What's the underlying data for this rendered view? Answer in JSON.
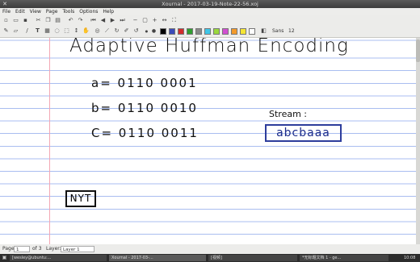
{
  "window": {
    "title": "Xournal - 2017-03-19-Note-22-56.xoj"
  },
  "menu": [
    "File",
    "Edit",
    "View",
    "Page",
    "Tools",
    "Options",
    "Help"
  ],
  "toolbar2": {
    "font": "Sans",
    "font_size": "12"
  },
  "colors": {
    "pen": "#111111",
    "stream_box": "#2d3d9c",
    "rule": "#a9bdf0",
    "margin": "#f3a6b4"
  },
  "swatches": [
    "#000000",
    "#3b4bb8",
    "#d12c2c",
    "#2f9e2f",
    "#8a8a8a",
    "#3ec6e8",
    "#9ad83c",
    "#d14fd1",
    "#f39a2a",
    "#f5e534",
    "#ffffff"
  ],
  "note": {
    "title": "Adaptive Huffman Encoding",
    "line_a": "a= 0110 0001",
    "line_b": "b= 0110 0010",
    "line_c": "C= 0110 0011",
    "stream_label": "Stream :",
    "stream_value": "abcbaaa",
    "nyt": "NYT"
  },
  "status": {
    "page_label": "Page",
    "page_value": "1",
    "page_of": "of 3",
    "layer_label": "Layer:",
    "layer_value": "Layer 1"
  },
  "taskbar": {
    "item1": "[wesley@ubuntu:...",
    "item2": "Xournal - 2017-03-...",
    "item3": "[视频]",
    "item4": "*无标题文档 1 - ge...",
    "clock": "10:08"
  }
}
